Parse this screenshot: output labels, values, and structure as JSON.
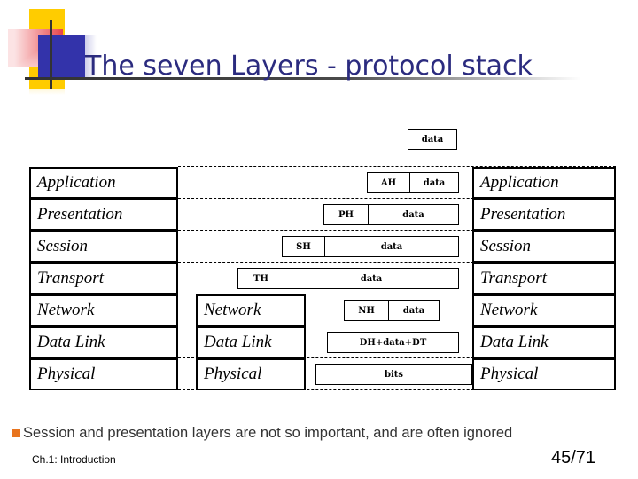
{
  "slide": {
    "title": "The seven Layers - protocol stack",
    "title_color": "#2B2B7F",
    "bullet_color": "#E8741E"
  },
  "diagram": {
    "top_pdu": {
      "label": "data"
    },
    "left_column": {
      "layers": [
        {
          "label": "Application"
        },
        {
          "label": "Presentation"
        },
        {
          "label": "Session"
        },
        {
          "label": "Transport"
        },
        {
          "label": "Network"
        },
        {
          "label": "Data Link"
        },
        {
          "label": "Physical"
        }
      ]
    },
    "middle_column": {
      "layers": [
        {
          "label": "Network"
        },
        {
          "label": "Data Link"
        },
        {
          "label": "Physical"
        }
      ]
    },
    "right_column": {
      "layers": [
        {
          "label": "Application"
        },
        {
          "label": "Presentation"
        },
        {
          "label": "Session"
        },
        {
          "label": "Transport"
        },
        {
          "label": "Network"
        },
        {
          "label": "Data Link"
        },
        {
          "label": "Physical"
        }
      ]
    },
    "encapsulation_rows": [
      {
        "layer": "Application",
        "header": "AH",
        "payload": "data"
      },
      {
        "layer": "Presentation",
        "header": "PH",
        "payload": "data"
      },
      {
        "layer": "Session",
        "header": "SH",
        "payload": "data"
      },
      {
        "layer": "Transport",
        "header": "TH",
        "payload": "data"
      },
      {
        "layer": "Network",
        "header": "NH",
        "payload": "data"
      },
      {
        "layer": "Data Link",
        "header": "",
        "payload": "DH+data+DT"
      },
      {
        "layer": "Physical",
        "header": "",
        "payload": "bits"
      }
    ]
  },
  "footer": {
    "note": "Session and presentation layers are not so important, and are often ignored",
    "chapter": "Ch.1: Introduction",
    "page": "45/71"
  }
}
